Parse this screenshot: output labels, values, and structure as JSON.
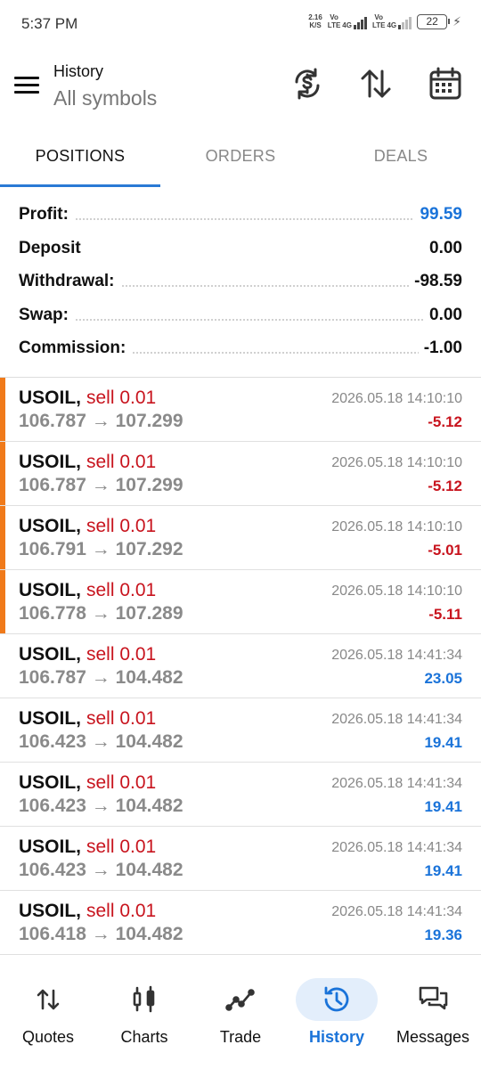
{
  "status_bar": {
    "time": "5:37 PM",
    "speed_value": "2.16",
    "speed_unit": "K/S",
    "net1_top": "Vo",
    "net1_bottom": "LTE",
    "net2_label": "4G",
    "net3_top": "Vo",
    "net3_bottom": "LTE",
    "net4_label": "4G",
    "battery": "22"
  },
  "header": {
    "title": "History",
    "subtitle": "All symbols",
    "icons": [
      "menu-icon",
      "currency-exchange-icon",
      "sort-icon",
      "calendar-icon"
    ]
  },
  "tabs": [
    {
      "label": "POSITIONS",
      "active": true
    },
    {
      "label": "ORDERS",
      "active": false
    },
    {
      "label": "DEALS",
      "active": false
    }
  ],
  "summary": [
    {
      "label": "Profit:",
      "value": "99.59"
    },
    {
      "label": "Deposit",
      "value": "0.00"
    },
    {
      "label": "Withdrawal:",
      "value": "-98.59"
    },
    {
      "label": "Swap:",
      "value": "0.00"
    },
    {
      "label": "Commission:",
      "value": "-1.00"
    }
  ],
  "deals": [
    {
      "symbol": "USOIL,",
      "side": "sell 0.01",
      "open": "106.787",
      "close": "107.299",
      "time": "2026.05.18 14:10:10",
      "profit": "-5.12"
    },
    {
      "symbol": "USOIL,",
      "side": "sell 0.01",
      "open": "106.787",
      "close": "107.299",
      "time": "2026.05.18 14:10:10",
      "profit": "-5.12"
    },
    {
      "symbol": "USOIL,",
      "side": "sell 0.01",
      "open": "106.791",
      "close": "107.292",
      "time": "2026.05.18 14:10:10",
      "profit": "-5.01"
    },
    {
      "symbol": "USOIL,",
      "side": "sell 0.01",
      "open": "106.778",
      "close": "107.289",
      "time": "2026.05.18 14:10:10",
      "profit": "-5.11"
    },
    {
      "symbol": "USOIL,",
      "side": "sell 0.01",
      "open": "106.787",
      "close": "104.482",
      "time": "2026.05.18 14:41:34",
      "profit": "23.05"
    },
    {
      "symbol": "USOIL,",
      "side": "sell 0.01",
      "open": "106.423",
      "close": "104.482",
      "time": "2026.05.18 14:41:34",
      "profit": "19.41"
    },
    {
      "symbol": "USOIL,",
      "side": "sell 0.01",
      "open": "106.423",
      "close": "104.482",
      "time": "2026.05.18 14:41:34",
      "profit": "19.41"
    },
    {
      "symbol": "USOIL,",
      "side": "sell 0.01",
      "open": "106.423",
      "close": "104.482",
      "time": "2026.05.18 14:41:34",
      "profit": "19.41"
    },
    {
      "symbol": "USOIL,",
      "side": "sell 0.01",
      "open": "106.418",
      "close": "104.482",
      "time": "2026.05.18 14:41:34",
      "profit": "19.36"
    }
  ],
  "price_arrow": "→",
  "bottom_nav": [
    {
      "label": "Quotes",
      "icon": "quotes-arrows-icon",
      "active": false
    },
    {
      "label": "Charts",
      "icon": "candlestick-icon",
      "active": false
    },
    {
      "label": "Trade",
      "icon": "trend-line-icon",
      "active": false
    },
    {
      "label": "History",
      "icon": "history-clock-icon",
      "active": true
    },
    {
      "label": "Messages",
      "icon": "chat-bubbles-icon",
      "active": false
    }
  ],
  "colors": {
    "accent_blue": "#1a73d9",
    "loss_red": "#c8141e",
    "flag_orange": "#f07a1a"
  }
}
